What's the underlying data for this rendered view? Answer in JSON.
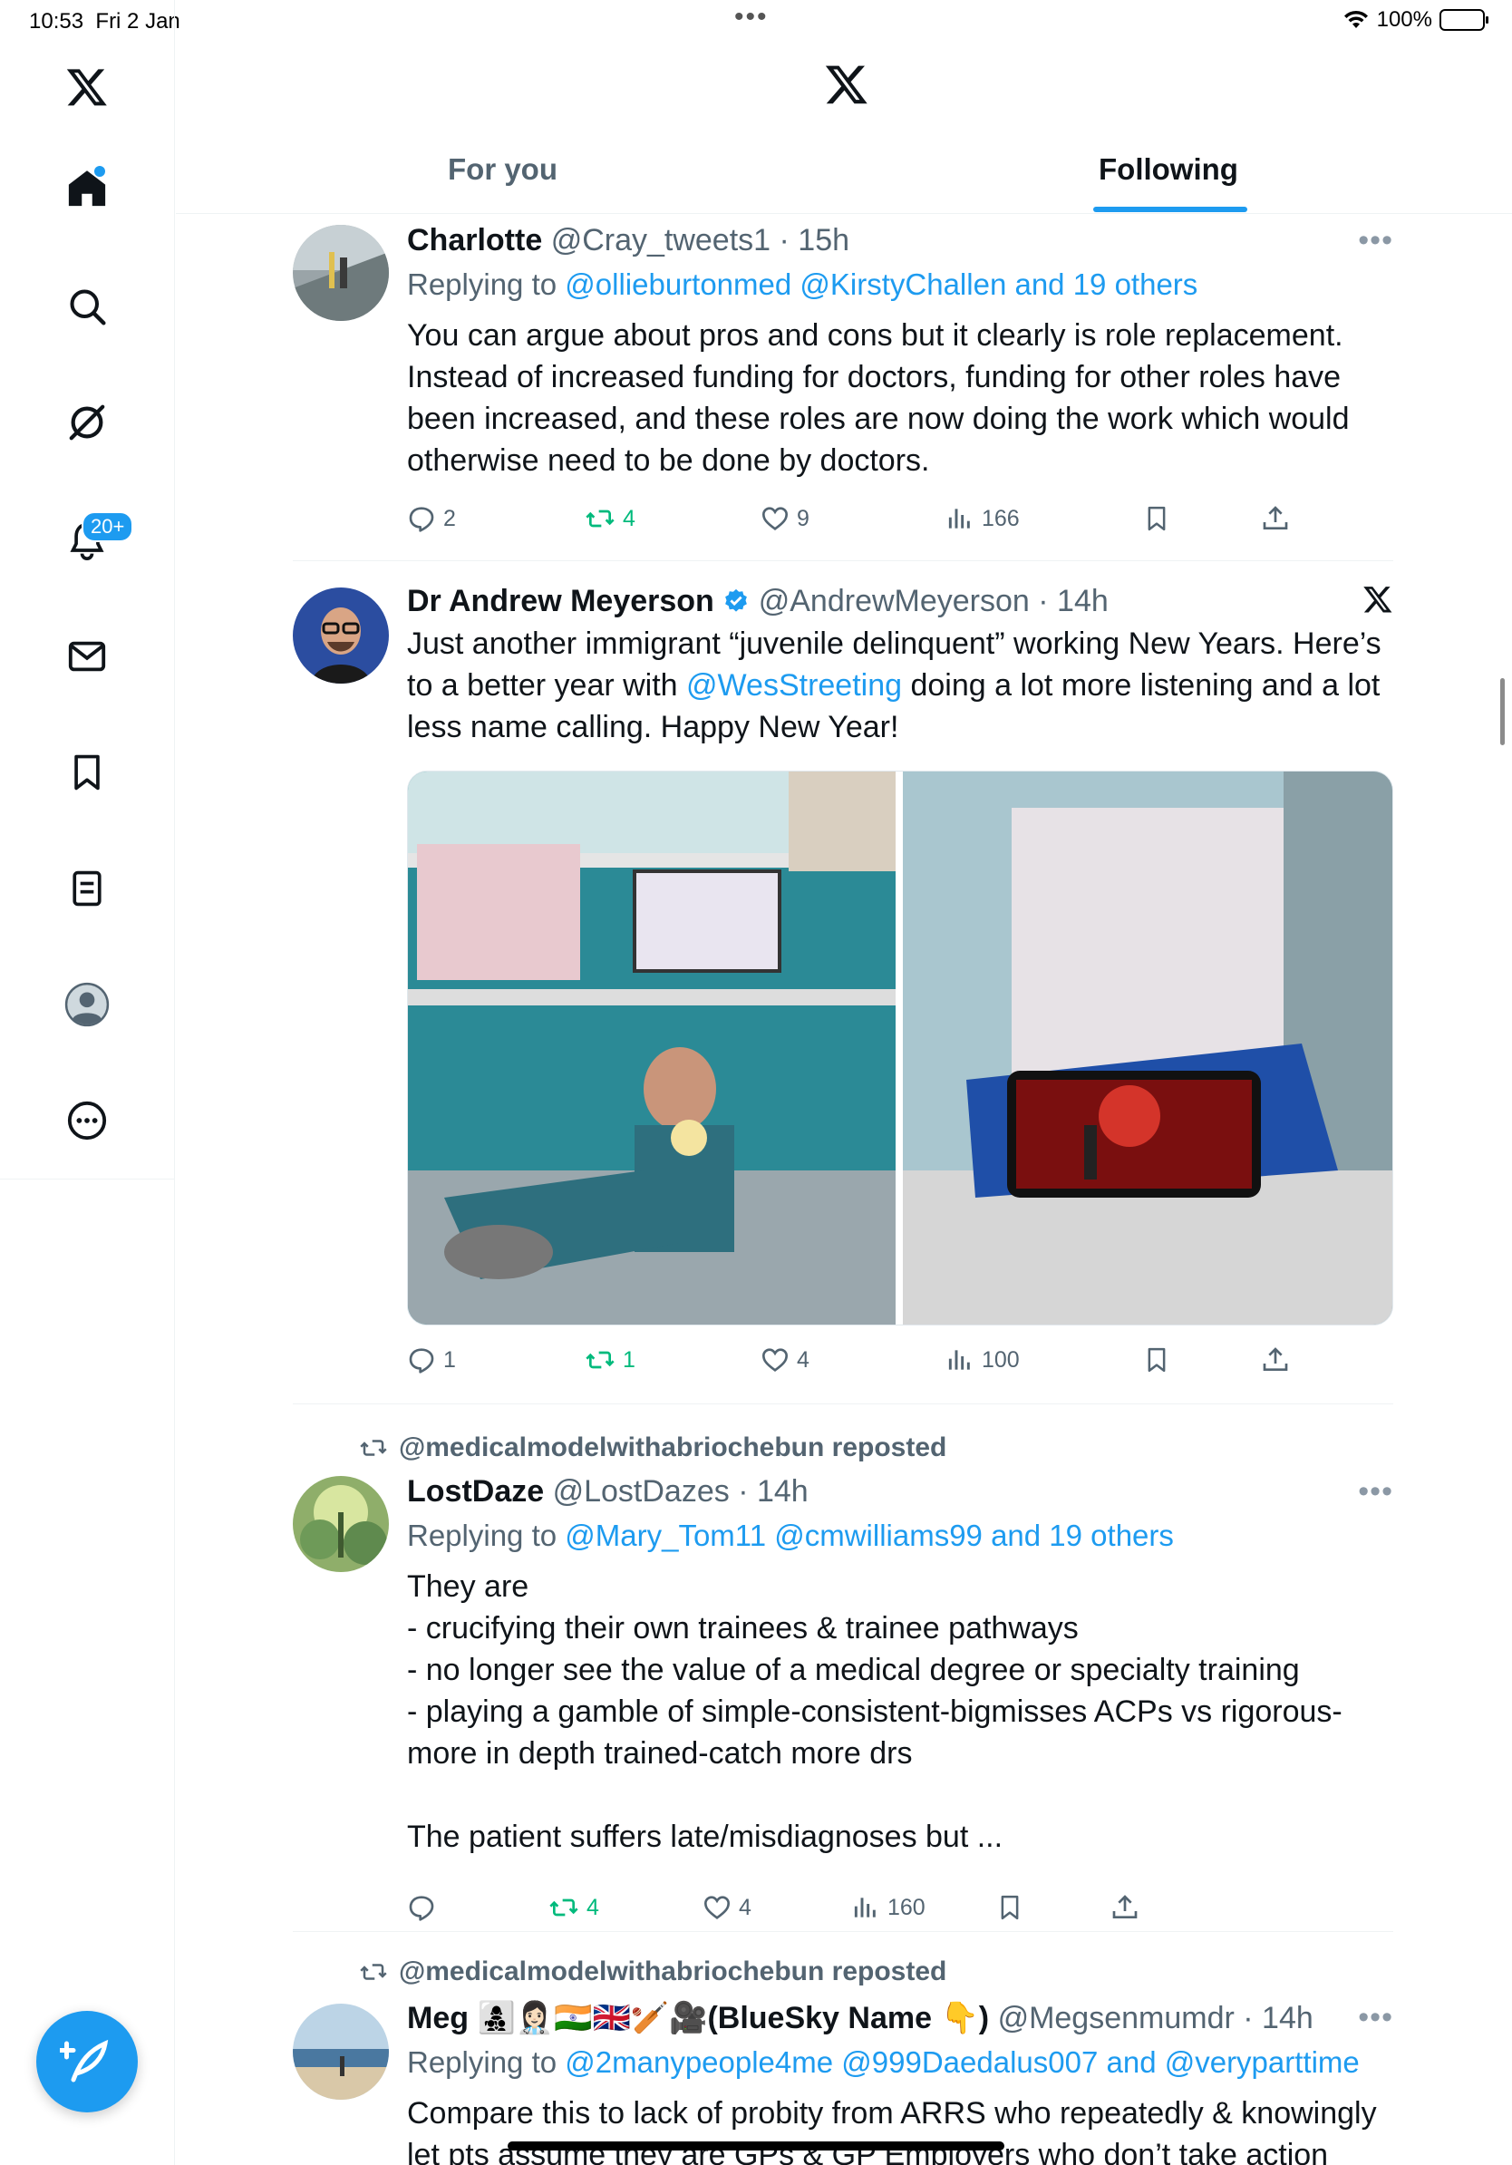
{
  "status_bar": {
    "time": "10:53",
    "date": "Fri 2 Jan",
    "battery": "100%"
  },
  "header": {
    "logo_icon": "x-logo-icon",
    "tabs": [
      {
        "label": "For you",
        "active": false
      },
      {
        "label": "Following",
        "active": true
      }
    ]
  },
  "sidebar": {
    "items": [
      {
        "name": "x-logo-icon"
      },
      {
        "name": "home-icon",
        "notification_dot": true
      },
      {
        "name": "search-icon"
      },
      {
        "name": "grok-icon"
      },
      {
        "name": "notifications-icon",
        "badge": "20+"
      },
      {
        "name": "messages-icon"
      },
      {
        "name": "bookmarks-icon"
      },
      {
        "name": "lists-icon"
      },
      {
        "name": "profile-icon"
      },
      {
        "name": "more-icon"
      }
    ],
    "compose_icon": "compose-post-icon"
  },
  "colors": {
    "accent": "#1d9bf0",
    "repost_green": "#00ba7c",
    "secondary_text": "#536471"
  },
  "tweets": [
    {
      "name": "Charlotte",
      "handle": "@Cray_tweets1",
      "time": "· 15h",
      "replying_prefix": "Replying to ",
      "replying_links": "@ollieburtonmed @KirstyChallen and 19 others",
      "text": "You can argue about pros and cons but it clearly is role replacement. Instead of increased funding for doctors, funding for other roles have been increased, and these roles are now doing the work which would otherwise need to be done by doctors.",
      "replies": "2",
      "reposts": "4",
      "likes": "9",
      "views": "166"
    },
    {
      "name": "Dr Andrew Meyerson",
      "verified": true,
      "handle": "@AndrewMeyerson",
      "time": "· 14h",
      "text_before": "Just another immigrant “juvenile delinquent” working New Years. Here’s to a better year with ",
      "mention": "@WesStreeting",
      "text_after": " doing a lot more listening and a lot less name calling. Happy New Year!",
      "replies": "1",
      "reposts": "1",
      "likes": "4",
      "views": "100"
    },
    {
      "reposted_by": "@medicalmodelwithabriochebun reposted",
      "name": "LostDaze",
      "handle": "@LostDazes",
      "time": "· 14h",
      "replying_prefix": "Replying to ",
      "replying_links": "@Mary_Tom11 @cmwilliams99 and 19 others",
      "text_lines": [
        "They are",
        "- crucifying their own trainees & trainee pathways",
        "- no longer see the value of a medical degree or specialty training",
        "- playing a gamble of simple-consistent-bigmisses ACPs vs rigorous-more in depth trained-catch more drs",
        "",
        "The patient suffers late/misdiagnoses but ..."
      ],
      "replies": "",
      "reposts": "4",
      "likes": "4",
      "views": "160"
    },
    {
      "reposted_by": "@medicalmodelwithabriochebun reposted",
      "name": "Meg 👩‍👧‍👦👩🏻‍⚕️🇮🇳🇬🇧🏏🎥(BlueSky Name 👇)",
      "handle": "@Megsenmumdr",
      "time": "· 14h",
      "replying_prefix": "Replying to ",
      "replying_links": "@2manypeople4me @999Daedalus007 and @veryparttime",
      "text": "Compare this to lack of probity from ARRS who repeatedly & knowingly let pts assume they are GPs & GP Employers who don’t take action"
    }
  ]
}
